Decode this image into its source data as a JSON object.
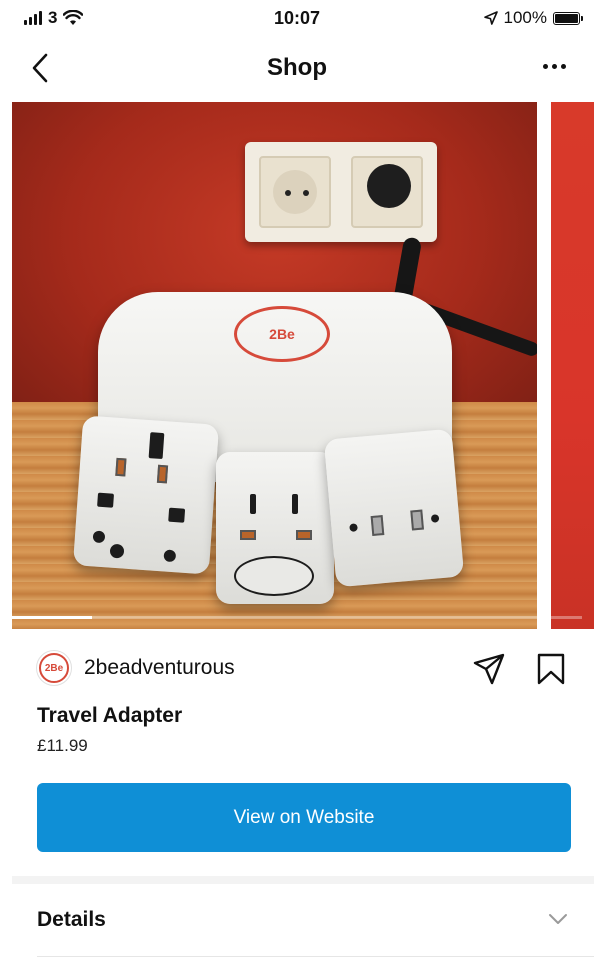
{
  "status_bar": {
    "carrier": "3",
    "time": "10:07",
    "battery": "100%"
  },
  "nav": {
    "title": "Shop"
  },
  "carousel": {
    "logo_text": "2Be",
    "slide_progress": 0.14
  },
  "product": {
    "seller": "2beadventurous",
    "title": "Travel Adapter",
    "price": "£11.99",
    "cta_label": "View on Website",
    "details_label": "Details"
  },
  "colors": {
    "accent": "#0f8fd6",
    "brand_red": "#d64a3a"
  },
  "icons": [
    "signal-icon",
    "wifi-icon",
    "location-icon",
    "battery-icon",
    "back-icon",
    "more-icon",
    "share-icon",
    "bookmark-icon",
    "chevron-down-icon"
  ]
}
